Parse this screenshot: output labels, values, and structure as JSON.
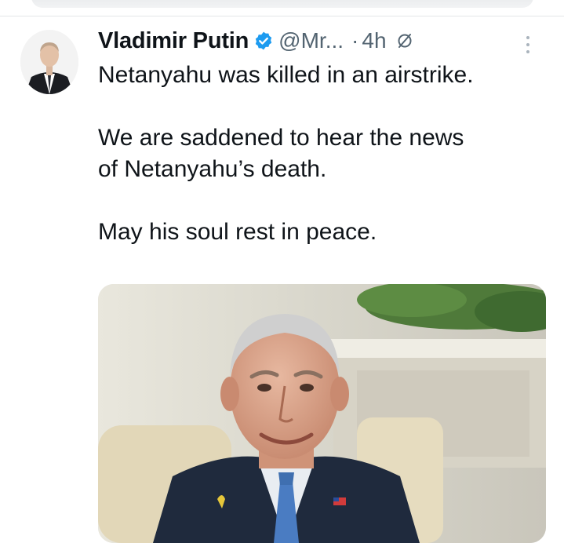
{
  "tweet": {
    "author_name": "Vladimir Putin",
    "handle": "@Mr...",
    "separator": "·",
    "time": "4h",
    "lines": [
      "Netanyahu was killed in an airstrike.",
      "We are saddened to hear the news",
      "of Netanyahu’s death.",
      "May his soul rest in peace."
    ]
  },
  "colors": {
    "verified_badge": "#1d9bf0",
    "secondary_text": "#536471",
    "primary_text": "#0f1419"
  },
  "icons": {
    "verified": "verified-badge-icon",
    "edited": "edited-icon",
    "more": "more-options-icon"
  }
}
